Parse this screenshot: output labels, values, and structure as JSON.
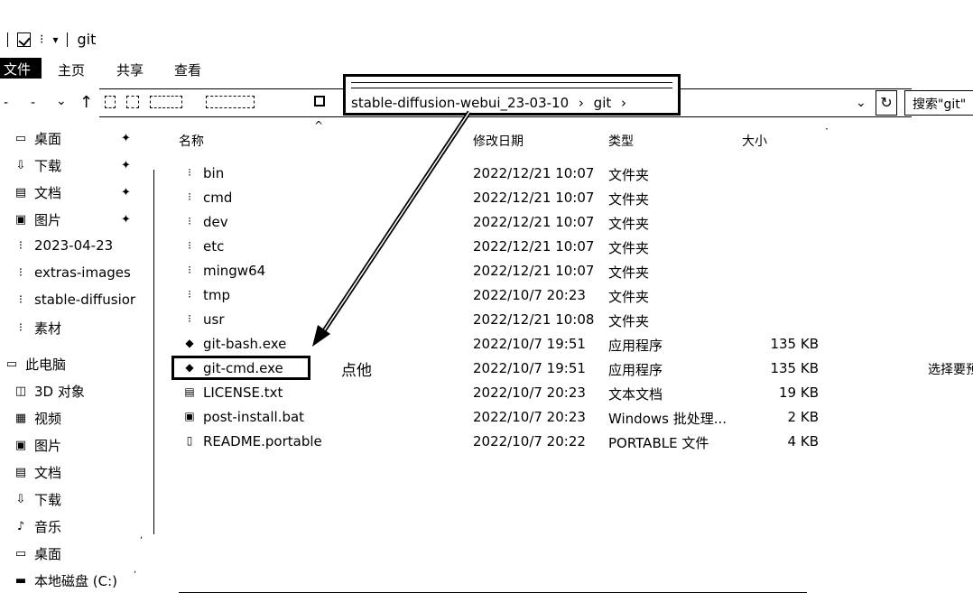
{
  "title_bar": {
    "title": "git",
    "qa_dropdown": "▾"
  },
  "ribbon": {
    "file_tab": "文件",
    "tabs": [
      "主页",
      "共享",
      "查看"
    ]
  },
  "nav": {
    "back": "←",
    "forward": "→",
    "recent": "⌄",
    "up": "↑"
  },
  "address": {
    "crumbs": [
      "stable-diffusion-webui_23-03-10",
      "git"
    ],
    "separator": "›",
    "dropdown": "⌄",
    "refresh": "↻",
    "search_placeholder": "搜索\"git\""
  },
  "sidebar": {
    "quick_access": [
      {
        "label": "桌面",
        "icon": "desktop-icon",
        "glyph": "▭",
        "pinned": true
      },
      {
        "label": "下载",
        "icon": "download-icon",
        "glyph": "⇩",
        "pinned": true
      },
      {
        "label": "文档",
        "icon": "document-icon",
        "glyph": "▤",
        "pinned": true
      },
      {
        "label": "图片",
        "icon": "picture-icon",
        "glyph": "▣",
        "pinned": true
      },
      {
        "label": "2023-04-23",
        "icon": "folder-icon",
        "glyph": "⁝",
        "pinned": false
      },
      {
        "label": "extras-images",
        "icon": "folder-icon",
        "glyph": "⁝",
        "pinned": false
      },
      {
        "label": "stable-diffusior",
        "icon": "folder-icon",
        "glyph": "⁝",
        "pinned": false
      },
      {
        "label": "素材",
        "icon": "folder-icon",
        "glyph": "⁝",
        "pinned": false
      }
    ],
    "pin_glyph": "✦",
    "this_pc": {
      "label": "此电脑",
      "icon": "computer-icon",
      "glyph": "▭"
    },
    "pc_items": [
      {
        "label": "3D 对象",
        "icon": "3d-objects-icon",
        "glyph": "◫"
      },
      {
        "label": "视频",
        "icon": "video-icon",
        "glyph": "▦"
      },
      {
        "label": "图片",
        "icon": "picture-icon",
        "glyph": "▣"
      },
      {
        "label": "文档",
        "icon": "document-icon",
        "glyph": "▤"
      },
      {
        "label": "下载",
        "icon": "download-icon",
        "glyph": "⇩"
      },
      {
        "label": "音乐",
        "icon": "music-icon",
        "glyph": "♪"
      },
      {
        "label": "桌面",
        "icon": "desktop-icon",
        "glyph": "▭"
      },
      {
        "label": "本地磁盘 (C:)",
        "icon": "drive-icon",
        "glyph": "▬"
      }
    ]
  },
  "columns": {
    "name": "名称",
    "date": "修改日期",
    "type": "类型",
    "size": "大小"
  },
  "files": [
    {
      "name": "bin",
      "date": "2022/12/21 10:07",
      "type": "文件夹",
      "size": "",
      "icon": "folder-icon"
    },
    {
      "name": "cmd",
      "date": "2022/12/21 10:07",
      "type": "文件夹",
      "size": "",
      "icon": "folder-icon"
    },
    {
      "name": "dev",
      "date": "2022/12/21 10:07",
      "type": "文件夹",
      "size": "",
      "icon": "folder-icon"
    },
    {
      "name": "etc",
      "date": "2022/12/21 10:07",
      "type": "文件夹",
      "size": "",
      "icon": "folder-icon"
    },
    {
      "name": "mingw64",
      "date": "2022/12/21 10:07",
      "type": "文件夹",
      "size": "",
      "icon": "folder-icon"
    },
    {
      "name": "tmp",
      "date": "2022/10/7 20:23",
      "type": "文件夹",
      "size": "",
      "icon": "folder-icon"
    },
    {
      "name": "usr",
      "date": "2022/12/21 10:08",
      "type": "文件夹",
      "size": "",
      "icon": "folder-icon"
    },
    {
      "name": "git-bash.exe",
      "date": "2022/10/7 19:51",
      "type": "应用程序",
      "size": "135 KB",
      "icon": "git-app-icon"
    },
    {
      "name": "git-cmd.exe",
      "date": "2022/10/7 19:51",
      "type": "应用程序",
      "size": "135 KB",
      "icon": "git-app-icon"
    },
    {
      "name": "LICENSE.txt",
      "date": "2022/10/7 20:23",
      "type": "文本文档",
      "size": "19 KB",
      "icon": "text-file-icon"
    },
    {
      "name": "post-install.bat",
      "date": "2022/10/7 20:23",
      "type": "Windows 批处理...",
      "size": "2 KB",
      "icon": "batch-file-icon"
    },
    {
      "name": "README.portable",
      "date": "2022/10/7 20:22",
      "type": "PORTABLE 文件",
      "size": "4 KB",
      "icon": "file-icon"
    }
  ],
  "annotation": "点他",
  "preview_hint": "选择要预"
}
